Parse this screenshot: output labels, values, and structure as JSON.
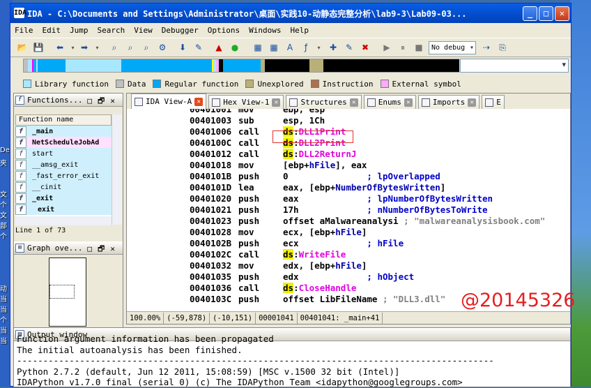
{
  "desktop": {
    "left_labels": [
      "",
      "",
      "",
      "",
      "​De",
      "​夹",
      "",
      "",
      "文",
      "个",
      "文",
      "部",
      "个",
      "",
      "",
      "",
      "",
      "动",
      "当",
      "当",
      "个",
      "当",
      "当"
    ],
    "right_strip": true
  },
  "window": {
    "title": "IDA - C:\\Documents and Settings\\Administrator\\桌面\\实践10-动静态完整分析\\lab9-3\\Lab09-03...",
    "icon_label": "IDA",
    "minimize_glyph": "_",
    "maximize_glyph": "□",
    "close_glyph": "✕"
  },
  "menubar": [
    "File",
    "Edit",
    "Jump",
    "Search",
    "View",
    "Debugger",
    "Options",
    "Windows",
    "Help"
  ],
  "toolbar": {
    "debugger_select": "No debug",
    "icons": [
      "open-icon",
      "save-icon",
      "back-icon",
      "forward-icon",
      "search-binary-icon",
      "search-text-icon",
      "search-imm-icon",
      "search-next-icon",
      "jump-down-icon",
      "mark-icon",
      "warning-icon",
      "run-green-icon",
      "make-code-icon",
      "make-data-icon",
      "make-string-icon",
      "make-array-icon",
      "add-struct-icon",
      "edit-func-icon",
      "delete-icon",
      "play-icon",
      "pause-icon",
      "stop-icon",
      "attach-icon",
      "detach-icon"
    ]
  },
  "legend": [
    {
      "label": "Library function",
      "color": "#a8e8ff"
    },
    {
      "label": "Data",
      "color": "#c0c0c0"
    },
    {
      "label": "Regular function",
      "color": "#00a8f8"
    },
    {
      "label": "Unexplored",
      "color": "#b8b078"
    },
    {
      "label": "Instruction",
      "color": "#b07050"
    },
    {
      "label": "External symbol",
      "color": "#ffa8ff"
    }
  ],
  "functions_panel": {
    "title": "Functions...",
    "column_header": "Function name",
    "items": [
      "_main",
      "NetScheduleJobAd",
      "start",
      "__amsg_exit",
      "_fast_error_exit",
      "__cinit",
      "_exit",
      "exit"
    ],
    "line_count": "Line 1 of 73"
  },
  "graph_panel": {
    "title": "Graph ove..."
  },
  "tabs": [
    "IDA View-A",
    "Hex View-1",
    "Structures",
    "Enums",
    "Imports",
    "E"
  ],
  "code": [
    {
      "addr": "00401001",
      "mn": "mov",
      "op": [
        {
          "t": "ebp, esp",
          "c": ""
        }
      ]
    },
    {
      "addr": "00401003",
      "mn": "sub",
      "op": [
        {
          "t": "esp, 1Ch",
          "c": ""
        }
      ]
    },
    {
      "addr": "00401006",
      "mn": "call",
      "op": [
        {
          "t": "ds",
          "c": "ds"
        },
        {
          "t": ":",
          "c": ""
        },
        {
          "t": "DLL1Print",
          "c": "mag"
        }
      ]
    },
    {
      "addr": "0040100C",
      "mn": "call",
      "op": [
        {
          "t": "ds",
          "c": "ds"
        },
        {
          "t": ":",
          "c": ""
        },
        {
          "t": "DLL2Print",
          "c": "mag"
        }
      ]
    },
    {
      "addr": "00401012",
      "mn": "call",
      "op": [
        {
          "t": "ds",
          "c": "ds"
        },
        {
          "t": ":",
          "c": ""
        },
        {
          "t": "DLL2ReturnJ",
          "c": "mag"
        }
      ]
    },
    {
      "addr": "00401018",
      "mn": "mov",
      "op": [
        {
          "t": "[ebp+",
          "c": ""
        },
        {
          "t": "hFile",
          "c": "nav"
        },
        {
          "t": "], eax",
          "c": ""
        }
      ]
    },
    {
      "addr": "0040101B",
      "mn": "push",
      "op": [
        {
          "t": "0",
          "c": ""
        },
        {
          "t": "               ; lpOverlapped",
          "c": "cm"
        }
      ]
    },
    {
      "addr": "0040101D",
      "mn": "lea",
      "op": [
        {
          "t": "eax, [ebp+",
          "c": ""
        },
        {
          "t": "NumberOfBytesWritten",
          "c": "nav"
        },
        {
          "t": "]",
          "c": ""
        }
      ]
    },
    {
      "addr": "00401020",
      "mn": "push",
      "op": [
        {
          "t": "eax",
          "c": ""
        },
        {
          "t": "             ; lpNumberOfBytesWritten",
          "c": "cm"
        }
      ]
    },
    {
      "addr": "00401021",
      "mn": "push",
      "op": [
        {
          "t": "17h",
          "c": ""
        },
        {
          "t": "             ; nNumberOfBytesToWrite",
          "c": "cm"
        }
      ]
    },
    {
      "addr": "00401023",
      "mn": "push",
      "op": [
        {
          "t": "offset aMalwareanalysi",
          "c": ""
        },
        {
          "t": " ; \"malwareanalysisbook.com\"",
          "c": "str"
        }
      ]
    },
    {
      "addr": "00401028",
      "mn": "mov",
      "op": [
        {
          "t": "ecx, [ebp+",
          "c": ""
        },
        {
          "t": "hFile",
          "c": "nav"
        },
        {
          "t": "]",
          "c": ""
        }
      ]
    },
    {
      "addr": "0040102B",
      "mn": "push",
      "op": [
        {
          "t": "ecx",
          "c": ""
        },
        {
          "t": "             ; hFile",
          "c": "cm"
        }
      ]
    },
    {
      "addr": "0040102C",
      "mn": "call",
      "op": [
        {
          "t": "ds",
          "c": "ds"
        },
        {
          "t": ":",
          "c": ""
        },
        {
          "t": "WriteFile",
          "c": "mag"
        }
      ]
    },
    {
      "addr": "00401032",
      "mn": "mov",
      "op": [
        {
          "t": "edx, [ebp+",
          "c": ""
        },
        {
          "t": "hFile",
          "c": "nav"
        },
        {
          "t": "]",
          "c": ""
        }
      ]
    },
    {
      "addr": "00401035",
      "mn": "push",
      "op": [
        {
          "t": "edx",
          "c": ""
        },
        {
          "t": "             ; hObject",
          "c": "cm"
        }
      ]
    },
    {
      "addr": "00401036",
      "mn": "call",
      "op": [
        {
          "t": "ds",
          "c": "ds"
        },
        {
          "t": ":",
          "c": ""
        },
        {
          "t": "CloseHandle",
          "c": "mag"
        }
      ]
    },
    {
      "addr": "0040103C",
      "mn": "push",
      "op": [
        {
          "t": "offset LibFileName",
          "c": ""
        },
        {
          "t": " ; \"DLL3.dll\"",
          "c": "str"
        }
      ]
    }
  ],
  "watermark": "@20145326",
  "status": [
    "100.00%",
    "(-59,878)",
    "(-10,151)",
    "00001041",
    "00401041: _main+41"
  ],
  "output": {
    "title": "Output window",
    "lines": [
      "Function argument information has been propagated",
      "The initial autoanalysis has been finished.",
      "-------------------------------------------------------------------------------------------",
      "Python 2.7.2 (default, Jun 12 2011, 15:08:59) [MSC v.1500 32 bit (Intel)]",
      "IDAPython v1.7.0 final (serial 0) (c) The IDAPython Team <idapython@googlegroups.com>"
    ]
  }
}
